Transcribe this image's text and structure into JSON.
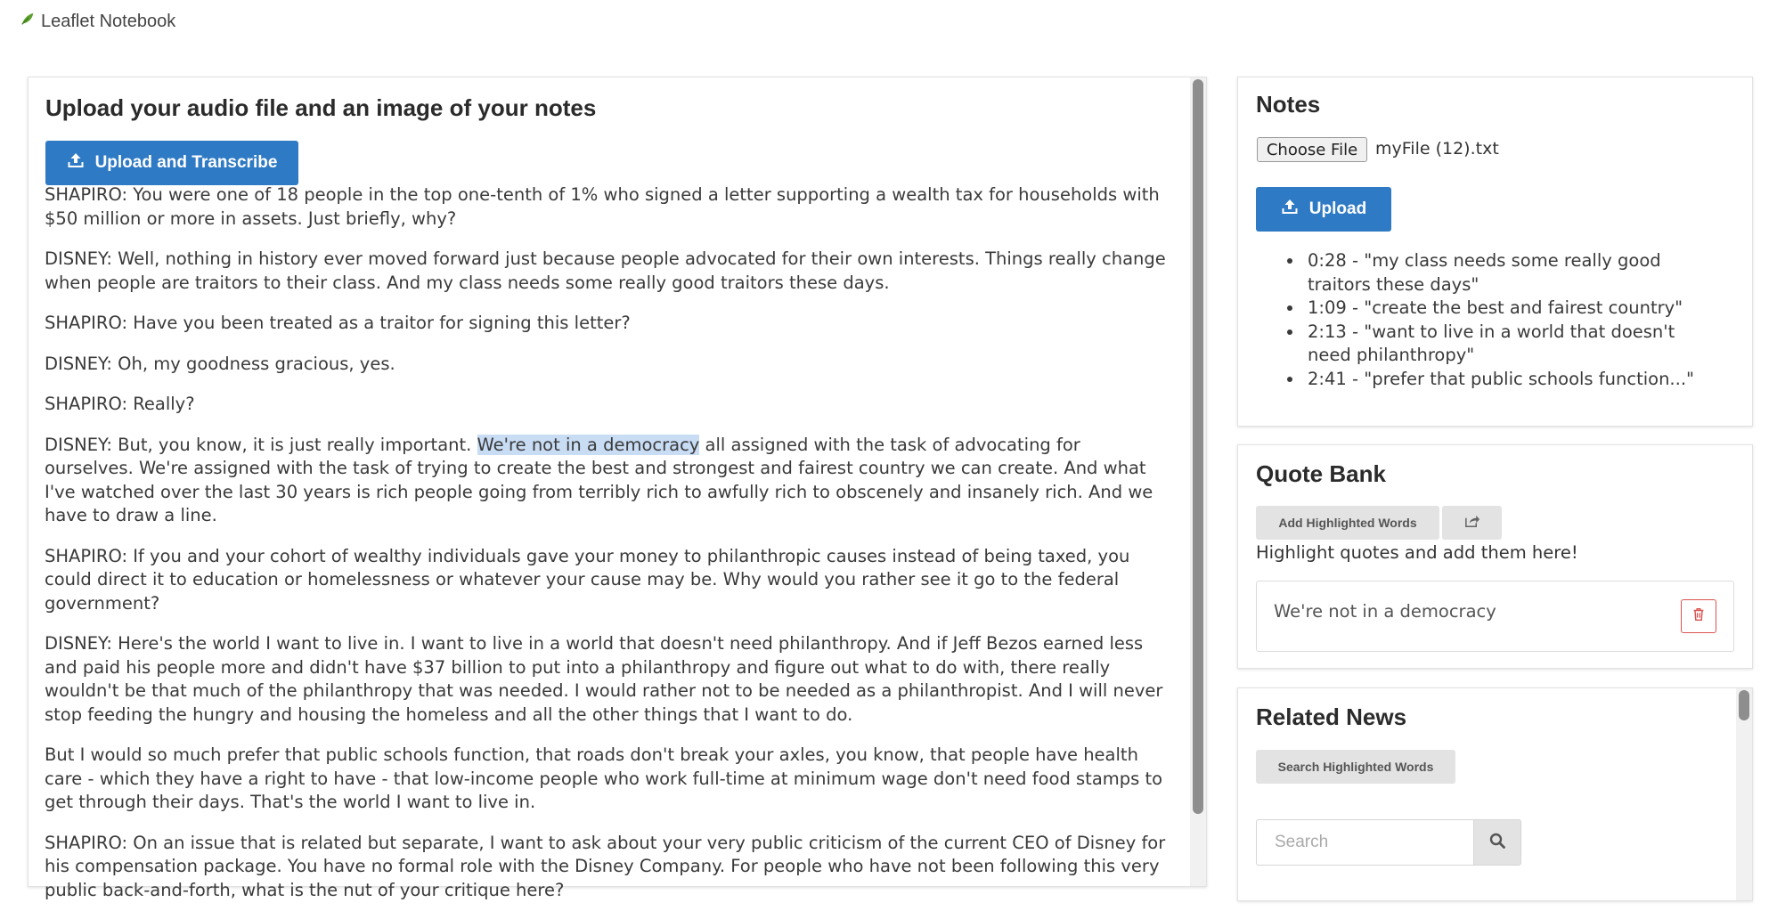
{
  "app": {
    "title": "Leaflet Notebook"
  },
  "transcribe": {
    "heading": "Upload your audio file and an image of your notes",
    "upload_button": "Upload and Transcribe"
  },
  "transcript": {
    "p1": "SHAPIRO: You were one of 18 people in the top one-tenth of 1% who signed a letter supporting a wealth tax for households with $50 million or more in assets. Just briefly, why?",
    "p2": "DISNEY: Well, nothing in history ever moved forward just because people advocated for their own interests. Things really change when people are traitors to their class. And my class needs some really good traitors these days.",
    "p3": "SHAPIRO: Have you been treated as a traitor for signing this letter?",
    "p4": "DISNEY: Oh, my goodness gracious, yes.",
    "p5": "SHAPIRO: Really?",
    "p6_before": "DISNEY: But, you know, it is just really important. ",
    "p6_highlight": "We're not in a democracy",
    "p6_after": " all assigned with the task of advocating for ourselves. We're assigned with the task of trying to create the best and strongest and fairest country we can create. And what I've watched over the last 30 years is rich people going from terribly rich to awfully rich to obscenely and insanely rich. And we have to draw a line.",
    "p7": "SHAPIRO: If you and your cohort of wealthy individuals gave your money to philanthropic causes instead of being taxed, you could direct it to education or homelessness or whatever your cause may be. Why would you rather see it go to the federal government?",
    "p8": "DISNEY: Here's the world I want to live in. I want to live in a world that doesn't need philanthropy. And if Jeff Bezos earned less and paid his people more and didn't have $37 billion to put into a philanthropy and figure out what to do with, there really wouldn't be that much of the philanthropy that was needed. I would rather not to be needed as a philanthropist. And I will never stop feeding the hungry and housing the homeless and all the other things that I want to do.",
    "p9": "But I would so much prefer that public schools function, that roads don't break your axles, you know, that people have health care - which they have a right to have - that low-income people who work full-time at minimum wage don't need food stamps to get through their days. That's the world I want to live in.",
    "p10": "SHAPIRO: On an issue that is related but separate, I want to ask about your very public criticism of the current CEO of Disney for his compensation package. You have no formal role with the Disney Company. For people who have not been following this very public back-and-forth, what is the nut of your critique here?"
  },
  "notes": {
    "heading": "Notes",
    "choose_file_label": "Choose File",
    "file_name": "myFile (12).txt",
    "upload_button": "Upload",
    "items": [
      "0:28 - \"my class needs some really good traitors these days\"",
      "1:09 - \"create the best and fairest country\"",
      "2:13 - \"want to live in a world that doesn't need philanthropy\"",
      "2:41 - \"prefer that public schools function...\""
    ]
  },
  "quote_bank": {
    "heading": "Quote Bank",
    "add_button": "Add Highlighted Words",
    "hint": "Highlight quotes and add them here!",
    "quotes": [
      "We're not in a democracy"
    ]
  },
  "related_news": {
    "heading": "Related News",
    "search_button": "Search Highlighted Words",
    "search_placeholder": "Search"
  },
  "icons": {
    "brand": "leaf-icon",
    "upload": "upload-icon",
    "share": "share-icon",
    "delete": "trash-icon",
    "search": "search-icon"
  },
  "colors": {
    "primary": "#2f7ac4",
    "highlight": "#c8dcf4",
    "danger": "#d9534f",
    "leaf": "#5aa02c"
  }
}
